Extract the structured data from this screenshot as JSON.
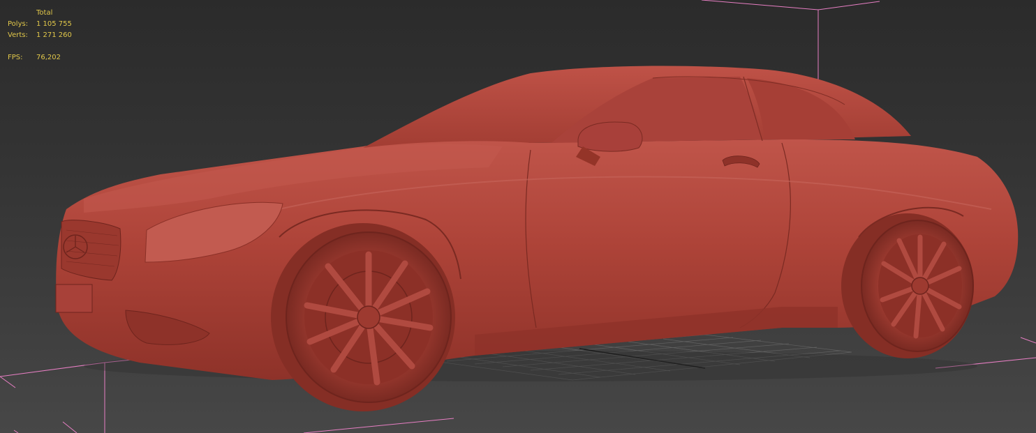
{
  "viewport": {
    "name": "perspective-viewport"
  },
  "stats": {
    "header": "Total",
    "polys_label": "Polys:",
    "polys_value": "1 105 755",
    "verts_label": "Verts:",
    "verts_value": "1 271 260",
    "fps_label": "FPS:",
    "fps_value": "76,202",
    "text_color": "#e2c84a"
  },
  "model": {
    "material_color": "#b5473d",
    "bounding_box_color": "#e87fc4",
    "grid_color": "#6a6a6a"
  }
}
